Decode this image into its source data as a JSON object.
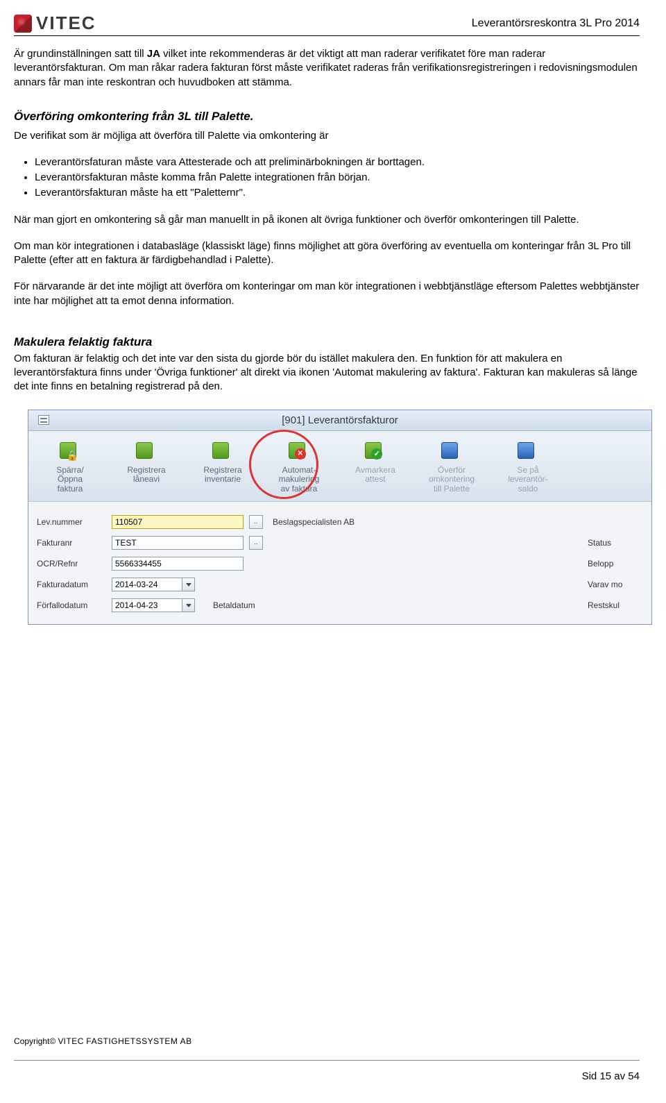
{
  "header": {
    "logo_text": "VITEC",
    "doc_title": "Leverantörsreskontra 3L Pro 2014"
  },
  "intro": {
    "p1_a": "Är grundinställningen satt till ",
    "p1_b": "JA",
    "p1_c": " vilket inte rekommenderas är det viktigt att man raderar verifikatet före man raderar leverantörsfakturan. Om man råkar radera fakturan först måste verifikatet raderas från verifikationsregistreringen i redovisningsmodulen annars får man inte reskontran och huvudboken att stämma."
  },
  "section1": {
    "heading": "Överföring omkontering från 3L till Palette.",
    "lead": "De verifikat som är möjliga att överföra till Palette via omkontering är",
    "bullets": [
      "Leverantörsfaturan måste vara Attesterade och att preliminärbokningen är borttagen.",
      "Leverantörsfakturan måste komma från Palette integrationen från början.",
      "Leverantörsfakturan måste ha ett  \"Paletternr\"."
    ],
    "p2": "När man gjort en omkontering så går man manuellt in på ikonen alt övriga funktioner och överför omkonteringen till Palette.",
    "p3": "Om man kör integrationen i databasläge (klassiskt läge) finns möjlighet att göra överföring av eventuella om konteringar från 3L Pro till Palette (efter att en faktura är färdigbehandlad i Palette).",
    "p4": "För närvarande är det inte möjligt att överföra om konteringar om man kör integrationen i webbtjänstläge eftersom Palettes webbtjänster inte har möjlighet att ta emot denna information."
  },
  "section2": {
    "heading": "Makulera felaktig faktura",
    "p1": "Om fakturan är felaktig och det inte var den sista du gjorde bör du istället makulera den. En funktion för att makulera en leverantörsfaktura finns under 'Övriga funktioner' alt direkt via ikonen 'Automat makulering av faktura'. Fakturan kan makuleras så länge det inte finns en betalning registrerad på den."
  },
  "app": {
    "title": "[901] Leverantörsfakturor",
    "toolbar": [
      {
        "label_lines": [
          "Spärra/",
          "Öppna",
          "faktura"
        ],
        "icon": "lock"
      },
      {
        "label_lines": [
          "Registrera",
          "låneavi"
        ],
        "icon": "doc"
      },
      {
        "label_lines": [
          "Registrera",
          "inventarie"
        ],
        "icon": "doc"
      },
      {
        "label_lines": [
          "Automat-",
          "makulering",
          "av faktura"
        ],
        "icon": "delete",
        "highlighted": true
      },
      {
        "label_lines": [
          "Avmarkera",
          "attest"
        ],
        "icon": "check",
        "disabled": true
      },
      {
        "label_lines": [
          "Överför",
          "omkontering",
          "till Palette"
        ],
        "icon": "transfer",
        "disabled": true
      },
      {
        "label_lines": [
          "Se på",
          "leverantör-",
          "saldo"
        ],
        "icon": "view",
        "disabled": true
      }
    ],
    "form": {
      "levnummer_label": "Lev.nummer",
      "levnummer_value": "110507",
      "lev_name": "Beslagspecialisten AB",
      "fakturanr_label": "Fakturanr",
      "fakturanr_value": "TEST",
      "status_label": "Status",
      "ocr_label": "OCR/Refnr",
      "ocr_value": "5566334455",
      "belopp_label": "Belopp",
      "fakturadatum_label": "Fakturadatum",
      "fakturadatum_value": "2014-03-24",
      "varav_label": "Varav mo",
      "forfallodatum_label": "Förfallodatum",
      "forfallodatum_value": "2014-04-23",
      "betaldatum_label": "Betaldatum",
      "restskul_label": "Restskul"
    }
  },
  "footer": {
    "copyright_a": "Copyright© V",
    "copyright_b": "ITEC",
    "copyright_c": " F",
    "copyright_d": "ASTIGHETSSYSTEM AB",
    "page": "Sid 15 av 54"
  }
}
